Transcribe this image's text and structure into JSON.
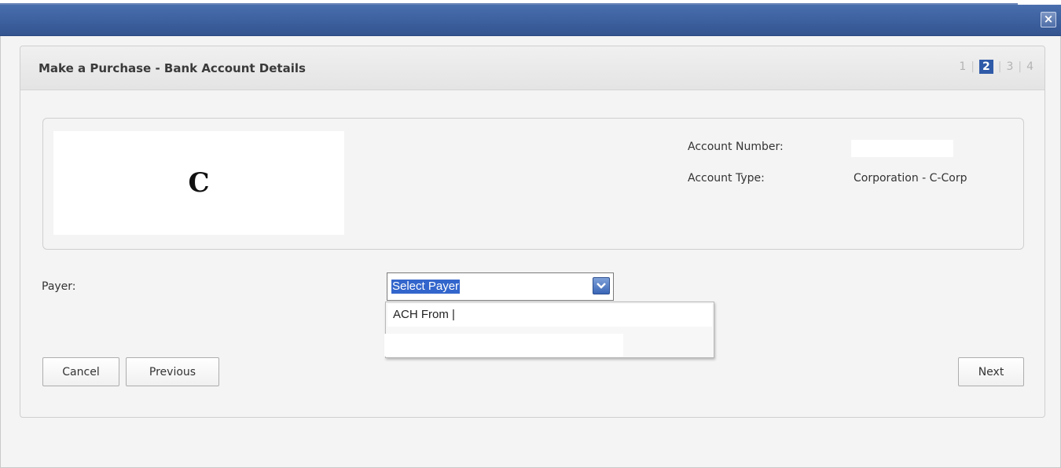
{
  "window": {
    "close_symbol": "×",
    "accent_color": "#3b5e9c"
  },
  "panel": {
    "title": "Make a Purchase - Bank Account Details",
    "steps": [
      "1",
      "2",
      "3",
      "4"
    ],
    "active_step": "2"
  },
  "account": {
    "logo_letter": "C",
    "number_label": "Account Number:",
    "number_value": "",
    "type_label": "Account Type:",
    "type_value": "Corporation - C-Corp"
  },
  "payer": {
    "label": "Payer:",
    "selected": "Select Payer",
    "options": [
      "ACH From |",
      ""
    ]
  },
  "buttons": {
    "cancel": "Cancel",
    "previous": "Previous",
    "next": "Next"
  },
  "icons": {
    "close": "close-icon",
    "dropdown": "chevron-down-icon"
  }
}
